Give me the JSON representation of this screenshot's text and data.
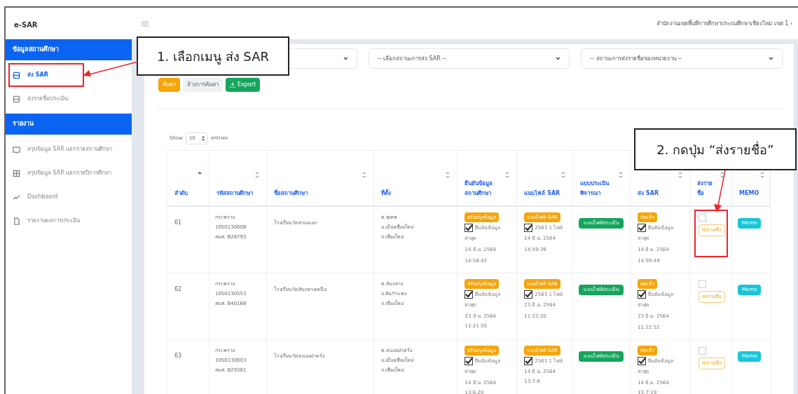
{
  "brand": "e-SAR",
  "breadcrumb": "สำนักงานเขตพื้นที่การศึกษาประถมศึกษาเชียงใหม่ เขต 1 ›",
  "sidebar": {
    "sections": [
      {
        "title": "ข้อมูลสถานศึกษา",
        "items": [
          {
            "label": "ส่ง SAR",
            "selected": true,
            "highlighted": true,
            "kind": "doc"
          },
          {
            "label": "ส่งรายชื่อประเมิน",
            "selected": false,
            "highlighted": false,
            "kind": "doc"
          }
        ]
      },
      {
        "title": "รายงาน",
        "items": [
          {
            "label": "สรุปข้อมูล SAR แยกรายสถานศึกษา",
            "selected": false,
            "highlighted": false,
            "kind": "book"
          },
          {
            "label": "สรุปข้อมูล SAR แยกรายปีการศึกษา",
            "selected": false,
            "highlighted": false,
            "kind": "grid"
          },
          {
            "label": "Dashboard",
            "selected": false,
            "highlighted": false,
            "kind": "chart"
          },
          {
            "label": "รายงานผลการประเมิน",
            "selected": false,
            "highlighted": false,
            "kind": "file"
          }
        ]
      }
    ]
  },
  "filters": [
    {
      "placeholder": "-- เลือกสถานะการส่ง SAR --"
    },
    {
      "placeholder": "-- สถานะการส่งรายชื่อของหน่วยงาน --"
    }
  ],
  "actions": [
    {
      "label": "ค้นหา",
      "kind": "search"
    },
    {
      "label": "ล้างการค้นหา",
      "kind": "clear"
    },
    {
      "label": "Export",
      "kind": "export"
    }
  ],
  "entries": {
    "before": "Show",
    "value": "10",
    "after": "entries"
  },
  "table": {
    "columns": [
      {
        "label": "ลำดับ",
        "sorted": true
      },
      {
        "label": "รหัสสถานศึกษา",
        "sorted": false
      },
      {
        "label": "ชื่อสถานศึกษา",
        "sorted": false
      },
      {
        "label": "ที่ตั้ง",
        "sorted": false
      },
      {
        "label": "ยืนยันข้อมูลสถานศึกษา",
        "sorted": false
      },
      {
        "label": "แนบไฟล์ SAR",
        "sorted": false
      },
      {
        "label": "แบบประเมินพิจารณา",
        "sorted": false
      },
      {
        "label": "ส่ง SAR",
        "sorted": false
      },
      {
        "label": "ส่งรายชื่อ",
        "sorted": false
      },
      {
        "label": "MEMO",
        "sorted": false
      }
    ],
    "rows": [
      {
        "no": "61",
        "code": [
          "กระทรวง",
          "1050130008",
          "สมศ. B28793"
        ],
        "name": "โรงเรียนวัดสวนดอก",
        "address": [
          "ต.สุเทพ",
          "อ.เมืองเชียงใหม่",
          "จ.เชียงใหม่"
        ],
        "confirm": {
          "button": "ปรับปรุงข้อมูล",
          "checked": true,
          "label": "ยืนยันข้อมูล",
          "lines": [
            "ล่าสุด",
            "14 มิ.ย. 2564",
            "14:58:42"
          ]
        },
        "sar_file": {
          "button": "แนบไฟล์ SAR",
          "checked": true,
          "label": "2563 1 ไฟล์",
          "lines": [
            "14 มิ.ย. 2564",
            "14:59:39"
          ]
        },
        "evaluation": {
          "button": "แนบไฟล์ประเมิน"
        },
        "send_sar": {
          "button": "ส่งแล้ว",
          "checked": true,
          "label": "ยืนยันข้อมูล",
          "lines": [
            "ล่าสุด",
            "14 มิ.ย. 2564",
            "14:59:49"
          ]
        },
        "send_names": {
          "checked": false,
          "button": "ส่งรายชื่อ",
          "highlighted": true
        },
        "memo": "Memo"
      },
      {
        "no": "62",
        "code": [
          "กระทรวง",
          "1050130553",
          "สมศ. B40166"
        ],
        "name": "โรงเรียนวัดสันกลางเหนือ",
        "address": [
          "ต.สันกลาง",
          "อ.สันกำแพง",
          "จ.เชียงใหม่"
        ],
        "confirm": {
          "button": "ปรับปรุงข้อมูล",
          "checked": true,
          "label": "ยืนยันข้อมูล",
          "lines": [
            "ล่าสุด",
            "23 มิ.ย. 2564 11:21:50"
          ]
        },
        "sar_file": {
          "button": "แนบไฟล์ SAR",
          "checked": true,
          "label": "2563 1 ไฟล์",
          "lines": [
            "23 มิ.ย. 2564",
            "11:22:20"
          ]
        },
        "evaluation": {
          "button": "แนบไฟล์ประเมิน"
        },
        "send_sar": {
          "button": "ส่งแล้ว",
          "checked": true,
          "label": "ยืนยันข้อมูล",
          "lines": [
            "ล่าสุด",
            "23 มิ.ย. 2564",
            "11:22:32"
          ]
        },
        "send_names": {
          "checked": false,
          "button": "ส่งรายชื่อ",
          "highlighted": false
        },
        "memo": "Memo"
      },
      {
        "no": "63",
        "code": [
          "กระทรวง",
          "1050130003",
          "สมศ. B29381"
        ],
        "name": "โรงเรียนวัดหนองป่าครั่ง",
        "address": [
          "ต.หนองป่าครั่ง",
          "อ.เมืองเชียงใหม่",
          "จ.เชียงใหม่"
        ],
        "confirm": {
          "button": "ปรับปรุงข้อมูล",
          "checked": true,
          "label": "ยืนยันข้อมูล",
          "lines": [
            "ล่าสุด",
            "14 มิ.ย. 2564 13:6:20"
          ]
        },
        "sar_file": {
          "button": "แนบไฟล์ SAR",
          "checked": true,
          "label": "2563 1 ไฟล์",
          "lines": [
            "14 มิ.ย. 2564 13:7:8"
          ]
        },
        "evaluation": {
          "button": "แนบไฟล์ประเมิน"
        },
        "send_sar": {
          "button": "ส่งแล้ว",
          "checked": true,
          "label": "ยืนยันข้อมูล",
          "lines": [
            "ล่าสุด",
            "14 มิ.ย. 2564 13:7:19"
          ]
        },
        "send_names": {
          "checked": false,
          "button": "ส่งรายชื่อ",
          "highlighted": false
        },
        "memo": "Memo"
      }
    ]
  },
  "annotations": [
    {
      "text": "1. เลือกเมนู ส่ง SAR"
    },
    {
      "text": "2. กดปุ่ม “ส่งรายชื่อ”"
    }
  ]
}
